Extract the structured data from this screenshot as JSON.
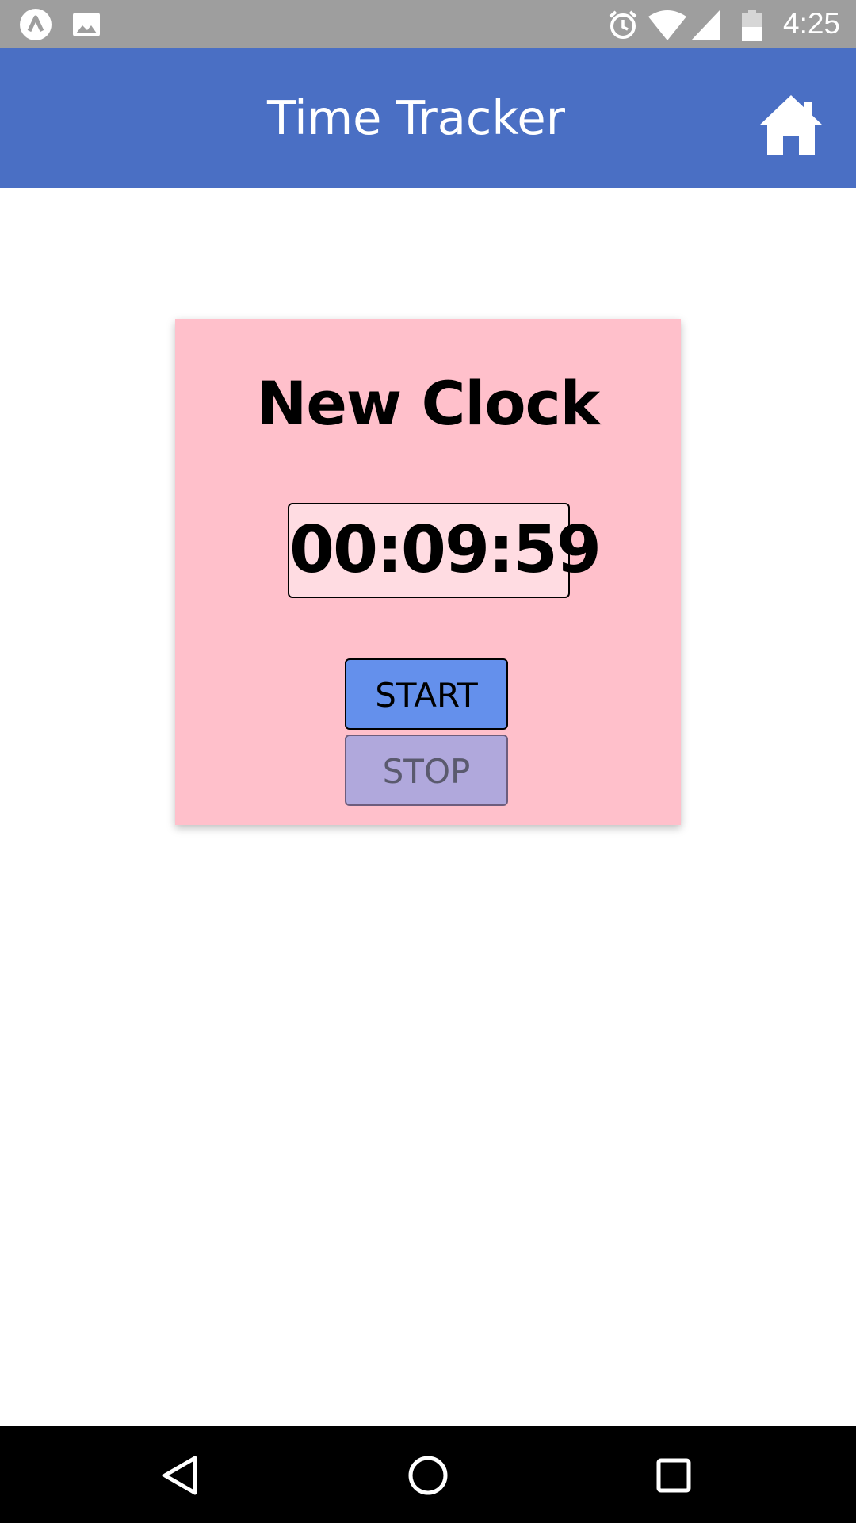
{
  "status_bar": {
    "time": "4:25",
    "left_icons": [
      "app-notification-icon",
      "image-notification-icon"
    ],
    "right_icons": [
      "alarm-icon",
      "wifi-icon",
      "cell-signal-icon",
      "battery-icon"
    ]
  },
  "app_bar": {
    "title": "Time Tracker",
    "home_icon": "home-icon",
    "color": "#4a6fc4"
  },
  "clock": {
    "title": "New Clock",
    "time": "00:09:59",
    "start_label": "START",
    "stop_label": "STOP",
    "card_color": "#ffc0cb",
    "start_color": "#6490ec",
    "stop_color": "#b0a8dc"
  },
  "nav_bar": {
    "buttons": [
      "back-icon",
      "home-circle-icon",
      "recents-icon"
    ]
  }
}
